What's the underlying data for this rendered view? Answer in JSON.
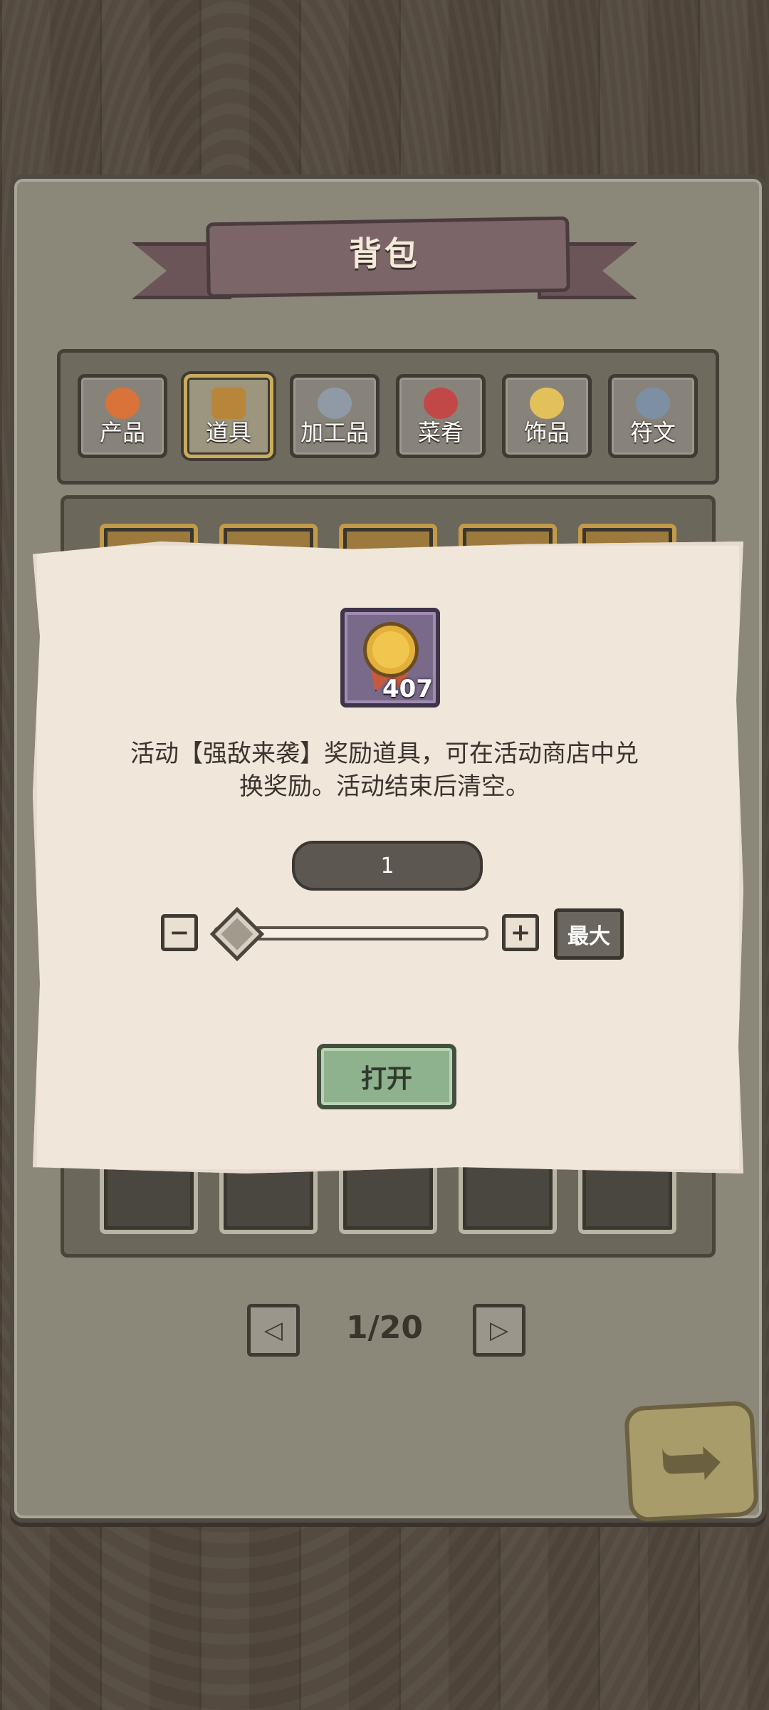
{
  "panel": {
    "title": "背包"
  },
  "tabs": [
    {
      "label": "产品",
      "icon": "carrot-icon",
      "active": false
    },
    {
      "label": "道具",
      "icon": "treasure-chest-icon",
      "active": true
    },
    {
      "label": "加工品",
      "icon": "wrench-icon",
      "active": false
    },
    {
      "label": "菜肴",
      "icon": "dish-icon",
      "active": false
    },
    {
      "label": "饰品",
      "icon": "crown-icon",
      "active": false
    },
    {
      "label": "符文",
      "icon": "rune-stone-icon",
      "active": false
    }
  ],
  "dialog": {
    "item_icon": "medal-icon",
    "item_count": "407",
    "description_line1": "活动【强敌来袭】奖励道具，可在活动商店中兑",
    "description_line2": "换奖励。活动结束后清空。",
    "quantity": "1",
    "minus_label": "−",
    "plus_label": "+",
    "max_label": "最大",
    "open_label": "打开"
  },
  "pager": {
    "page_text": "1/20",
    "prev_icon": "arrow-left-icon",
    "next_icon": "arrow-right-icon"
  },
  "return_icon": "return-arrow-icon"
}
